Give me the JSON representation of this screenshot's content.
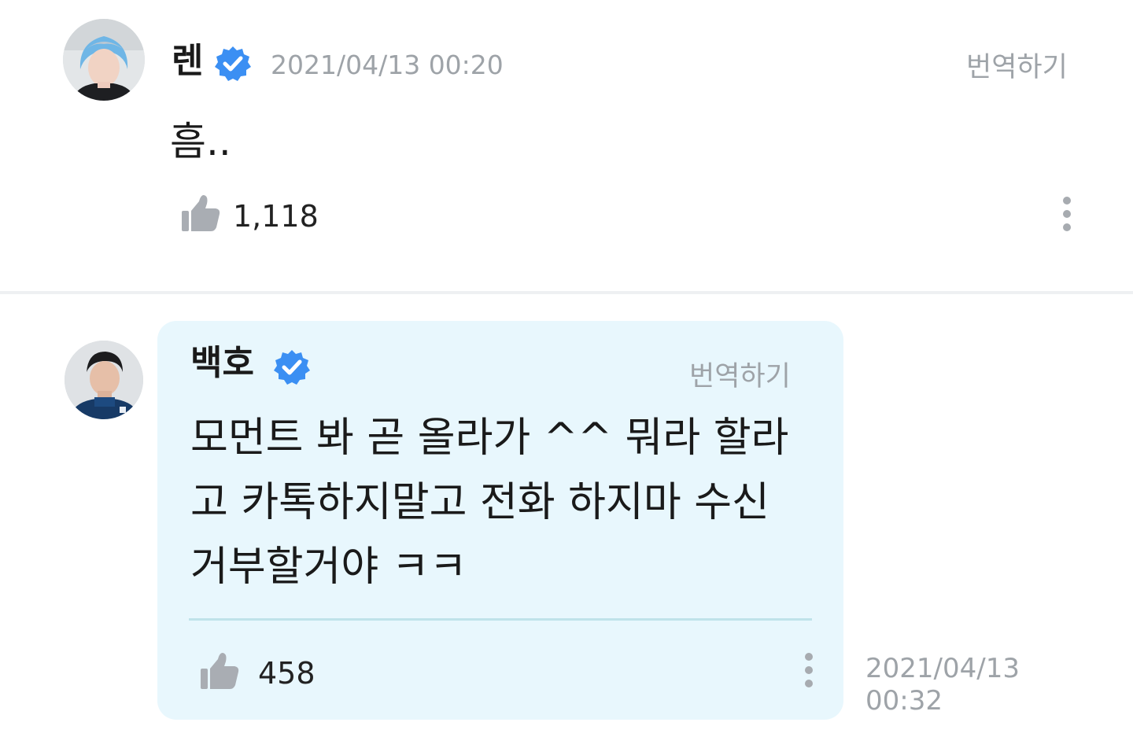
{
  "posts": [
    {
      "author": "렌",
      "verified": true,
      "timestamp": "2021/04/13 00:20",
      "translate_label": "번역하기",
      "body": "흠..",
      "likes": "1,118"
    },
    {
      "author": "백호",
      "verified": true,
      "translate_label": "번역하기",
      "body_lines": [
        "모먼트 봐 곧 올라가 ^^ 뭐라 할라",
        "고 카톡하지말고 전화 하지마 수신",
        "거부할거야 ㅋㅋ"
      ],
      "likes": "458",
      "timestamp_date": "2021/04/13",
      "timestamp_time": "00:32"
    }
  ],
  "colors": {
    "verified_badge": "#3b8ff3",
    "bubble_background": "#e8f7fd",
    "muted_text": "#9ea3a8",
    "like_icon": "#a9adb3"
  },
  "icons": {
    "verified": "verified-badge-icon",
    "like": "thumbs-up-icon",
    "more": "more-vertical-icon"
  }
}
